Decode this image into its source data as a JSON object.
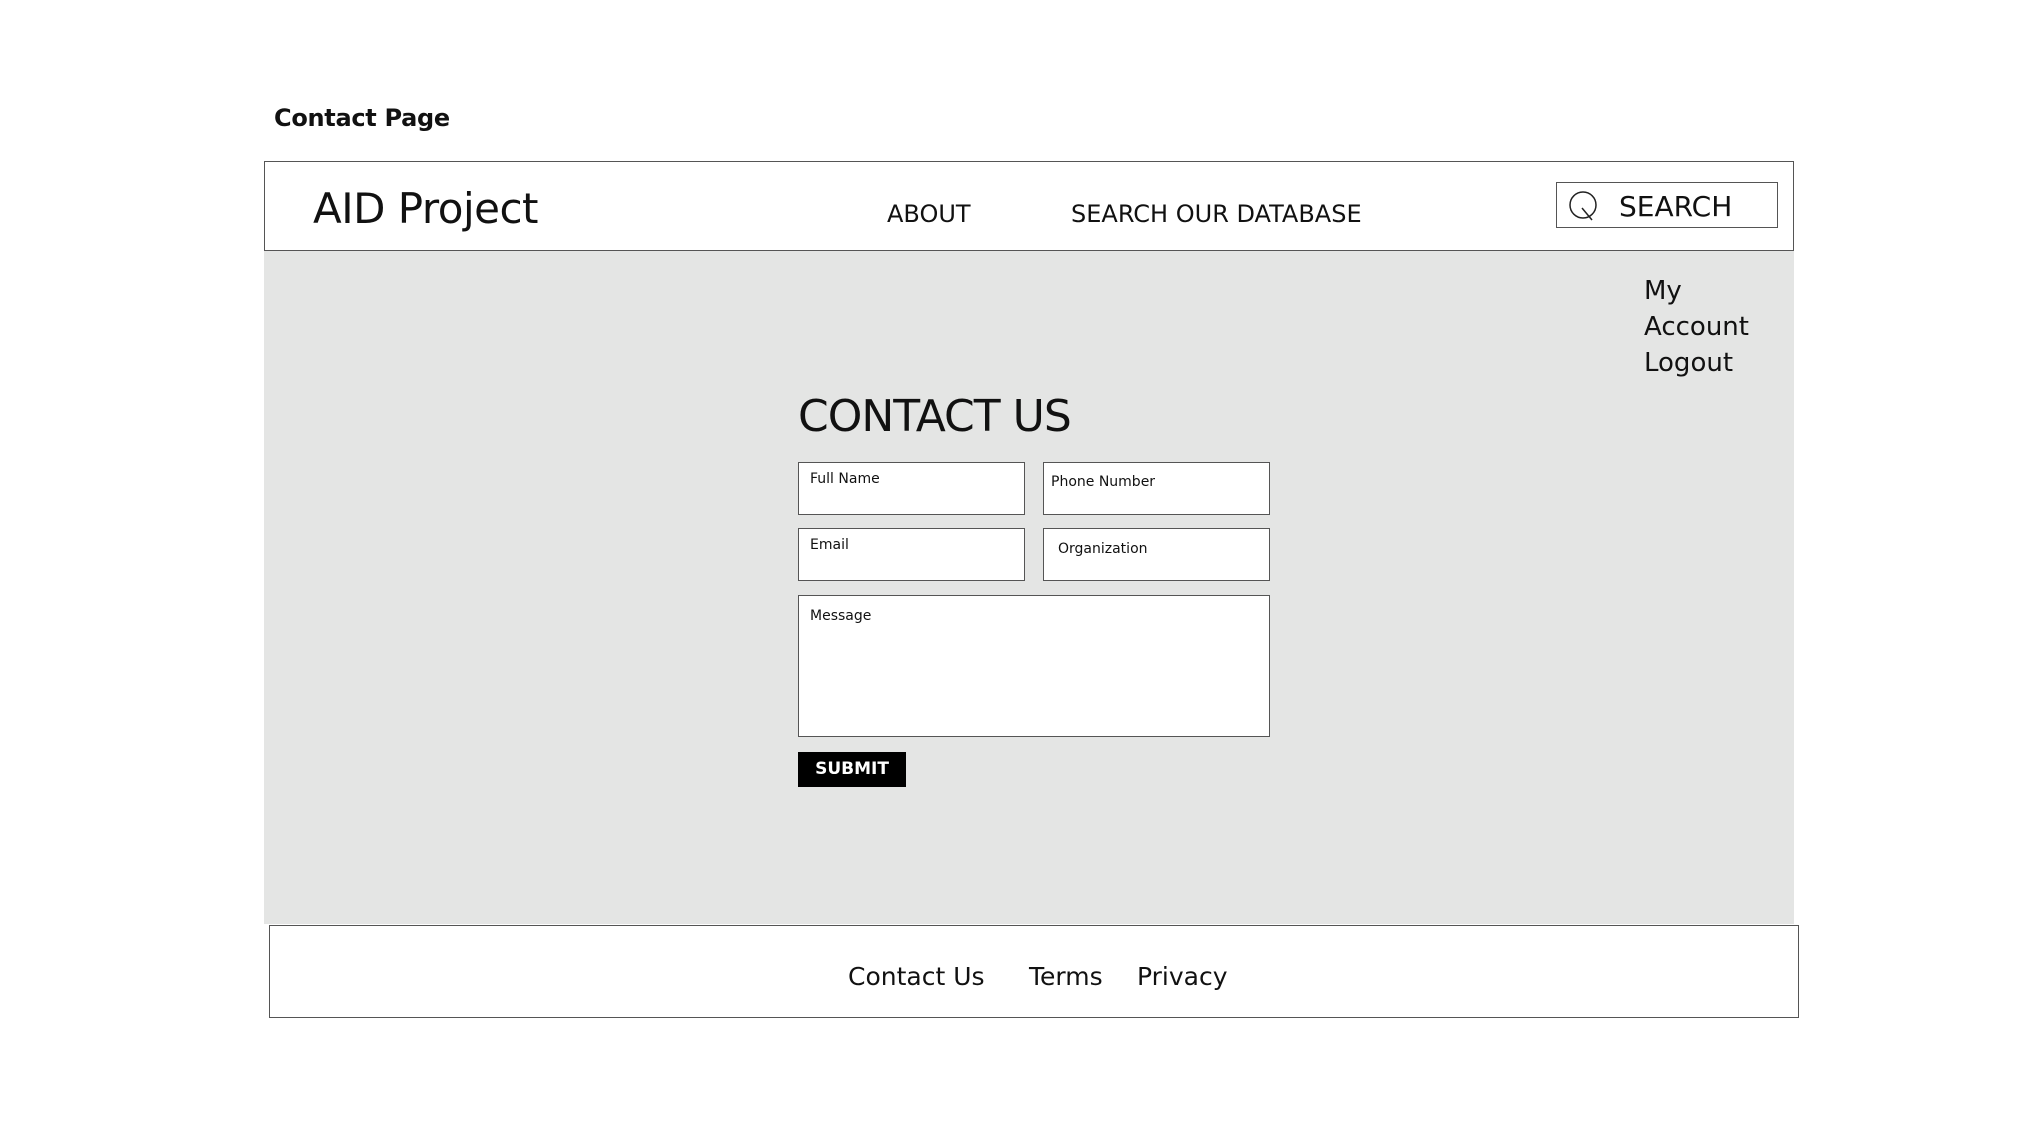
{
  "page_label": "Contact Page",
  "header": {
    "brand": "AID Project",
    "nav": {
      "about": "ABOUT",
      "search_database": "SEARCH OUR DATABASE"
    },
    "search": {
      "label": "SEARCH",
      "icon": "search-icon"
    }
  },
  "account": {
    "my_account": "My Account",
    "logout": "Logout"
  },
  "contact_form": {
    "title": "CONTACT US",
    "fields": {
      "full_name": "Full Name",
      "phone_number": "Phone Number",
      "email": "Email",
      "organization": "Organization",
      "message": "Message"
    },
    "submit_label": "SUBMIT"
  },
  "footer": {
    "contact_us": "Contact Us",
    "terms": "Terms",
    "privacy": "Privacy"
  },
  "colors": {
    "content_background": "#e4e5e4",
    "border": "#555555",
    "button_background": "#000000",
    "button_text": "#ffffff"
  }
}
